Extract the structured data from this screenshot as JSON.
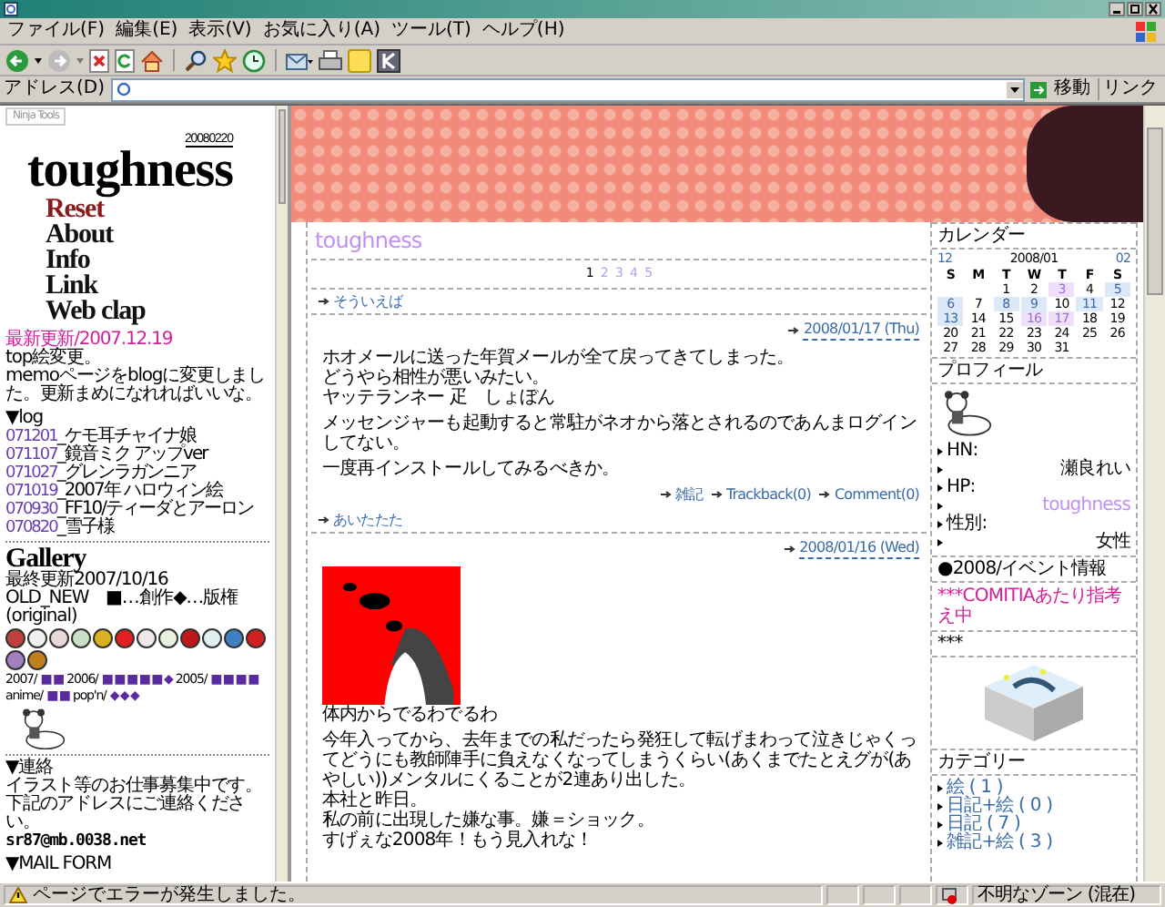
{
  "menu": [
    "ファイル(F)",
    "編集(E)",
    "表示(V)",
    "お気に入り(A)",
    "ツール(T)",
    "ヘルプ(H)"
  ],
  "address": {
    "label": "アドレス(D)",
    "go": "移動",
    "links": "リンク"
  },
  "left": {
    "badge": "Ninja Tools",
    "logo_date": "20080220",
    "logo": "toughness",
    "nav": [
      {
        "label": "Reset",
        "selected": true
      },
      {
        "label": "About",
        "selected": false
      },
      {
        "label": "Info",
        "selected": false
      },
      {
        "label": "Link",
        "selected": false
      },
      {
        "label": "Web clap",
        "selected": false
      }
    ],
    "update_title": "最新更新/2007.12.19",
    "update_lines": [
      "top絵変更。",
      "memoページをblogに変更しました。更新まめになれればいいな。"
    ],
    "log_title": "▼log",
    "log": [
      {
        "date": "071201",
        "title": "_ケモ耳チャイナ娘"
      },
      {
        "date": "071107",
        "title": "_鏡音ミク アップver"
      },
      {
        "date": "071027",
        "title": "_グレンラガンニア"
      },
      {
        "date": "071019",
        "title": "_2007年 ハロウィン絵"
      },
      {
        "date": "070930",
        "title": "_FF10/ティーダとアーロン"
      },
      {
        "date": "070820",
        "title": "_雪子様"
      }
    ],
    "gallery_title": "Gallery",
    "gallery_updated": "最終更新2007/10/16",
    "gallery_legend": "OLD_NEW　■…創作◆…版権(original)",
    "thumbnails": [
      {
        "color": "#c04040"
      },
      {
        "color": "#f0f0f0"
      },
      {
        "color": "#e8d8d8"
      },
      {
        "color": "#c8e0c8"
      },
      {
        "color": "#d8b020"
      },
      {
        "color": "#e02020"
      },
      {
        "color": "#f0e8e8"
      },
      {
        "color": "#e8f0e0"
      },
      {
        "color": "#c01818"
      },
      {
        "color": "#e0f0f0"
      },
      {
        "color": "#4080c0"
      },
      {
        "color": "#d02020"
      },
      {
        "color": "#a080c0"
      },
      {
        "color": "#c08020"
      }
    ],
    "archive_rows": [
      [
        {
          "label": "2007/",
          "marks": "■ ■"
        },
        {
          "label": "2006/",
          "marks": "■ ■ ■ ■ ■ ◆"
        },
        {
          "label": "2005/",
          "marks": "■ ■ ■ ■"
        }
      ],
      [
        {
          "label": "anime/",
          "marks": "■ ■"
        },
        {
          "label": "pop'n/",
          "marks": "◆ ◆ ◆"
        }
      ]
    ],
    "contact_title": "▼連絡",
    "contact_lines": [
      "イラスト等のお仕事募集中です。",
      "下記のアドレスにご連絡ください。"
    ],
    "email": "sr87@mb.0038.net",
    "mailform": "▼MAIL FORM"
  },
  "blog": {
    "title": "toughness",
    "pages": [
      {
        "label": "1",
        "selected": true
      },
      {
        "label": "2",
        "selected": false
      },
      {
        "label": "3",
        "selected": false
      },
      {
        "label": "4",
        "selected": false
      },
      {
        "label": "5",
        "selected": false
      }
    ],
    "posts": [
      {
        "title": "そういえば",
        "date": "2008/01/17 (Thu)",
        "body": [
          [
            "ホオメールに送った年賀メールが全て戻ってきてしまった。",
            "どうやら相性が悪いみたい。",
            "ヤッテランネー 疋　しょぼん"
          ],
          [
            "メッセンジャーも起動すると常駐がネオから落とされるのであんまログインしてない。"
          ],
          [
            "一度再インストールしてみるべきか。"
          ]
        ],
        "links": [
          "雑記",
          "Trackback(0)",
          "Comment(0)"
        ]
      },
      {
        "title": "あいたたた",
        "date": "2008/01/16 (Wed)",
        "image_caption": "体内からでるわでるわ",
        "body": [
          [
            "今年入ってから、去年までの私だったら発狂して転げまわって泣きじゃくってどうにも教師陣手に負えなくなってしまうくらい(あくまでたとえグが(あやしい))メンタルにくることが2連あり出した。",
            "本社と昨日。",
            "私の前に出現した嫌な事。嫌＝ショック。",
            "すげぇな2008年！もう見入れな！"
          ]
        ]
      }
    ]
  },
  "sidebar": {
    "calendar_title": "カレンダー",
    "prev": "12",
    "month": "2008/01",
    "next": "02",
    "weekdays": [
      "S",
      "M",
      "T",
      "W",
      "T",
      "F",
      "S"
    ],
    "weeks": [
      [
        {
          "day": "1",
          "kind": "plain"
        },
        {
          "day": "2",
          "kind": "plain"
        },
        {
          "day": "3",
          "kind": "visited"
        },
        {
          "day": "4",
          "kind": "plain"
        },
        {
          "day": "5",
          "kind": "entry"
        }
      ],
      [
        {
          "day": "6",
          "kind": "entry"
        },
        {
          "day": "7",
          "kind": "plain"
        },
        {
          "day": "8",
          "kind": "entry"
        },
        {
          "day": "9",
          "kind": "entry"
        },
        {
          "day": "10",
          "kind": "plain"
        },
        {
          "day": "11",
          "kind": "entry"
        },
        {
          "day": "12",
          "kind": "plain"
        }
      ],
      [
        {
          "day": "13",
          "kind": "entry"
        },
        {
          "day": "14",
          "kind": "plain"
        },
        {
          "day": "15",
          "kind": "plain"
        },
        {
          "day": "16",
          "kind": "visited"
        },
        {
          "day": "17",
          "kind": "visited"
        },
        {
          "day": "18",
          "kind": "plain"
        },
        {
          "day": "19",
          "kind": "plain"
        }
      ],
      [
        {
          "day": "20",
          "kind": "plain"
        },
        {
          "day": "21",
          "kind": "plain"
        },
        {
          "day": "22",
          "kind": "plain"
        },
        {
          "day": "23",
          "kind": "plain"
        },
        {
          "day": "24",
          "kind": "plain"
        },
        {
          "day": "25",
          "kind": "plain"
        },
        {
          "day": "26",
          "kind": "plain"
        }
      ],
      [
        {
          "day": "27",
          "kind": "plain"
        },
        {
          "day": "28",
          "kind": "plain"
        },
        {
          "day": "29",
          "kind": "plain"
        },
        {
          "day": "30",
          "kind": "plain"
        },
        {
          "day": "31",
          "kind": "plain"
        }
      ]
    ],
    "profile_title": "プロフィール",
    "profile": [
      {
        "text": "HN:",
        "kind": "label"
      },
      {
        "text": "瀬良れい",
        "kind": "value"
      },
      {
        "text": "HP:",
        "kind": "label"
      },
      {
        "text": "toughness",
        "kind": "link"
      },
      {
        "text": "性別:",
        "kind": "label"
      },
      {
        "text": "女性",
        "kind": "value"
      }
    ],
    "event_title": "●2008/イベント情報",
    "event_text": "***COMITIAあたり指考え中",
    "art_title": "***",
    "category_title": "カテゴリー",
    "categories": [
      "絵 ( 1 )",
      "日記+絵 ( 0 )",
      "日記 ( 7 )",
      "雑記+絵 ( 3 )"
    ]
  },
  "status": {
    "message": "ページでエラーが発生しました。",
    "zone": "不明なゾーン (混在)"
  }
}
